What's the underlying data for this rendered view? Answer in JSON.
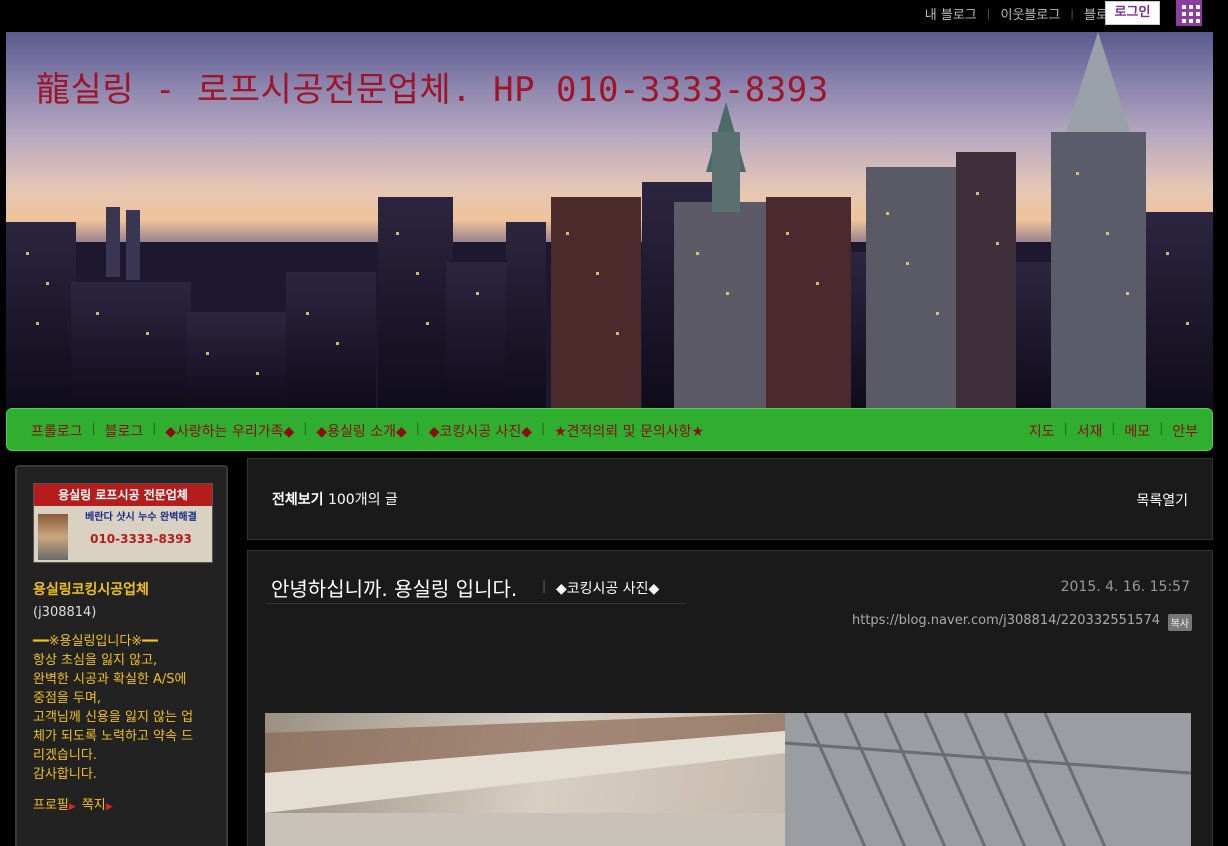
{
  "topbar": {
    "links": [
      "내 블로그",
      "이웃블로그",
      "블로그 홈"
    ],
    "login_label": "로그인"
  },
  "header": {
    "title": "龍실링 - 로프시공전문업체. HP 010-3333-8393"
  },
  "nav": {
    "left": [
      "프롤로그",
      "블로그",
      "◆사랑하는 우리가족◆",
      "◆용실링 소개◆",
      "◆코킹시공 사진◆",
      "★견적의뢰 및 문의사항★"
    ],
    "right": [
      "지도",
      "서재",
      "메모",
      "안부"
    ]
  },
  "sidebar": {
    "profile_image": {
      "line1": "용실링 로프시공 전문업체",
      "line2": "베란다 샷시 누수 완벽해결",
      "line3": "010-3333-8393"
    },
    "name": "용실링코킹시공업체",
    "id": "(j308814)",
    "description": "━━※용실링입니다※━━\n항상 초심을 잃지 않고,\n완벽한 시공과 확실한 A/S에\n중점을 두며,\n고객님께 신용을 잃지 않는 업체가 되도록 노력하고 약속 드리겠습니다.\n감사합니다.",
    "link_profile": "프로필",
    "link_message": "쪽지"
  },
  "list": {
    "all_label": "전체보기",
    "count": "100개의 글",
    "open_label": "목록열기"
  },
  "post": {
    "title": "안녕하십니까. 용실링 입니다.",
    "category": "◆코킹시공 사진◆",
    "date": "2015. 4. 16. 15:57",
    "url": "https://blog.naver.com/j308814/220332551574",
    "copy_label": "복사"
  },
  "colors": {
    "nav_bg": "#2fae2f",
    "nav_text": "#8b0d12",
    "title_red": "#a01428",
    "sidebar_text": "#f0c020",
    "login_text": "#7b2f8e"
  }
}
